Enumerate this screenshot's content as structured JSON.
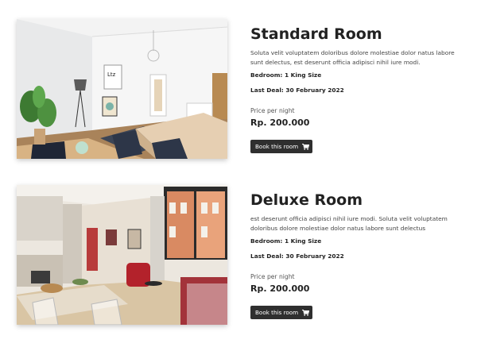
{
  "rooms": [
    {
      "title": "Standard Room",
      "description": "Soluta velit voluptatem doloribus dolore molestiae dolor natus labore sunt delectus, est deserunt officia adipisci nihil iure modi.",
      "bedroom": "Bedroom: 1 King Size",
      "last_deal": "Last Deal: 30 February 2022",
      "price_label": "Price per night",
      "price": "Rp. 200.000",
      "button_label": "Book this room",
      "button_icon": "cart-icon"
    },
    {
      "title": "Deluxe Room",
      "description": "est deserunt officia adipisci nihil iure modi. Soluta velit voluptatem doloribus dolore molestiae dolor natus labore sunt delectus",
      "bedroom": "Bedroom: 1 King Size",
      "last_deal": "Last Deal: 30 February 2022",
      "price_label": "Price per night",
      "price": "Rp. 200.000",
      "button_label": "Book this room",
      "button_icon": "cart-icon"
    }
  ],
  "colors": {
    "button_bg": "#2f2f2f",
    "button_text": "#ffffff",
    "title_text": "#222222"
  }
}
